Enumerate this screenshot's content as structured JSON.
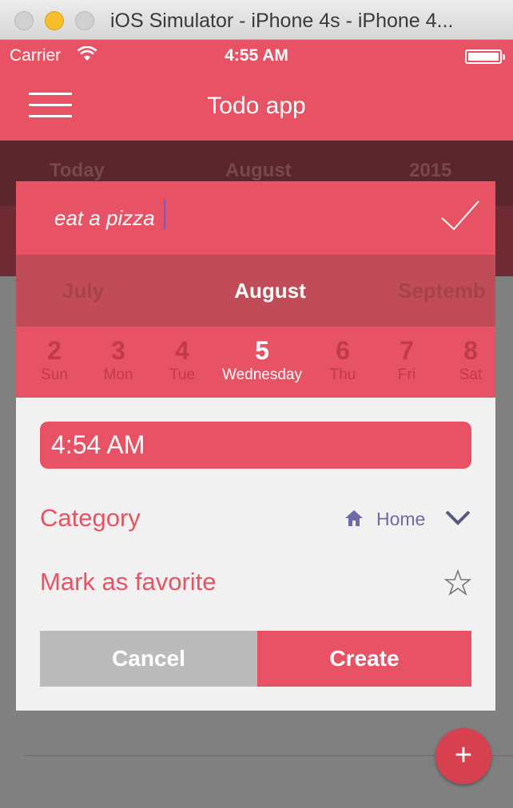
{
  "window": {
    "title": "iOS Simulator - iPhone 4s - iPhone 4..."
  },
  "statusbar": {
    "carrier": "Carrier",
    "time": "4:55 AM"
  },
  "navbar": {
    "title": "Todo app",
    "menu_icon": "hamburger-menu-icon"
  },
  "background": {
    "labels": [
      "Today",
      "August",
      "2015"
    ]
  },
  "task": {
    "value": "eat a pizza",
    "confirm_icon": "checkmark-icon"
  },
  "months": {
    "prev": "July",
    "current": "August",
    "next": "Septemb"
  },
  "days": [
    {
      "num": "2",
      "name": "Sun"
    },
    {
      "num": "3",
      "name": "Mon"
    },
    {
      "num": "4",
      "name": "Tue"
    },
    {
      "num": "5",
      "name": "Wednesday",
      "selected": true
    },
    {
      "num": "6",
      "name": "Thu"
    },
    {
      "num": "7",
      "name": "Fri"
    },
    {
      "num": "8",
      "name": "Sat"
    }
  ],
  "time": {
    "value": "4:54 AM"
  },
  "category": {
    "label": "Category",
    "value": "Home",
    "icon": "home-icon"
  },
  "favorite": {
    "label": "Mark as favorite",
    "icon": "star-outline-icon"
  },
  "actions": {
    "cancel": "Cancel",
    "create": "Create"
  },
  "fab": {
    "label": "+"
  },
  "colors": {
    "accent": "#e75364",
    "month_bar": "#c04c58",
    "category_text": "#6d6aa6"
  }
}
